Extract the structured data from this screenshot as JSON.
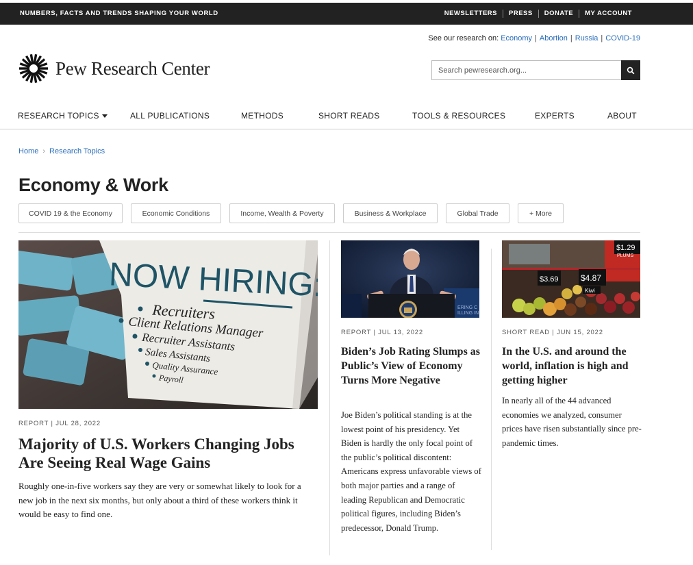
{
  "topbar": {
    "tagline": "NUMBERS, FACTS AND TRENDS SHAPING YOUR WORLD",
    "links": [
      "NEWSLETTERS",
      "PRESS",
      "DONATE",
      "MY ACCOUNT"
    ]
  },
  "research_on": {
    "label": "See our research on:",
    "topics": [
      "Economy",
      "Abortion",
      "Russia",
      "COVID-19"
    ]
  },
  "logo": {
    "name": "Pew Research Center",
    "icon": "pew-sunburst-icon"
  },
  "search": {
    "placeholder": "Search pewresearch.org...",
    "icon": "search-icon"
  },
  "nav": [
    "RESEARCH TOPICS",
    "ALL PUBLICATIONS",
    "METHODS",
    "SHORT READS",
    "TOOLS & RESOURCES",
    "EXPERTS",
    "ABOUT"
  ],
  "breadcrumb": [
    "Home",
    "Research Topics"
  ],
  "page_title": "Economy & Work",
  "chips": [
    "COVID 19 & the Economy",
    "Economic Conditions",
    "Income, Wealth & Poverty",
    "Business & Workplace",
    "Global Trade",
    "+ More"
  ],
  "articles": [
    {
      "meta": "REPORT | JUL 28, 2022",
      "headline": "Majority of U.S. Workers Changing Jobs Are Seeing Real Wage Gains",
      "dek": "Roughly one-in-five workers say they are very or somewhat likely to look for a new job in the next six months, but only about a third of these workers think it would be easy to find one.",
      "image": {
        "title": "NOW HIRING:",
        "items": [
          "Recruiters",
          "Client Relations Manager",
          "Recruiter Assistants",
          "Sales Assistants",
          "Quality Assurance",
          "Payroll"
        ]
      }
    },
    {
      "meta": "REPORT | JUL 13, 2022",
      "headline": "Biden’s Job Rating Slumps as Public’s View of Economy Turns More Negative",
      "dek": "Joe Biden’s political standing is at the lowest point of his presidency. Yet Biden is hardly the only focal point of the public’s political discontent: Americans express unfavorable views of both major parties and a range of leading Republican and Democratic political figures, including Biden’s predecessor, Donald Trump."
    },
    {
      "meta": "SHORT READ | JUN 15, 2022",
      "headline": "In the U.S. and around the world, inflation is high and getting higher",
      "dek": "In nearly all of the 44 advanced economies we analyzed, consumer prices have risen substantially since pre-pandemic times.",
      "image": {
        "prices": [
          "$3.69",
          "$4.87",
          "$1.29",
          "Kiwi",
          "PLUMS"
        ]
      }
    }
  ]
}
